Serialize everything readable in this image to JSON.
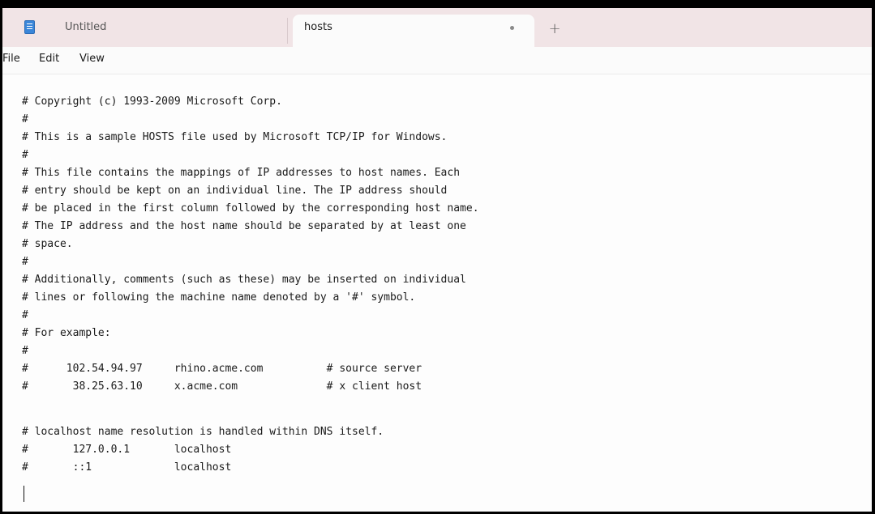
{
  "tabs": [
    {
      "label": "Untitled",
      "active": false
    },
    {
      "label": "hosts",
      "active": true,
      "unsaved_indicator": "•"
    }
  ],
  "new_tab_label": "+",
  "menu": [
    "File",
    "Edit",
    "View"
  ],
  "editor": {
    "lines": [
      "# Copyright (c) 1993-2009 Microsoft Corp.",
      "#",
      "# This is a sample HOSTS file used by Microsoft TCP/IP for Windows.",
      "#",
      "# This file contains the mappings of IP addresses to host names. Each",
      "# entry should be kept on an individual line. The IP address should",
      "# be placed in the first column followed by the corresponding host name.",
      "# The IP address and the host name should be separated by at least one",
      "# space.",
      "#",
      "# Additionally, comments (such as these) may be inserted on individual",
      "# lines or following the machine name denoted by a '#' symbol.",
      "#",
      "# For example:",
      "#",
      "#      102.54.94.97     rhino.acme.com          # source server",
      "#       38.25.63.10     x.acme.com              # x client host",
      "",
      "# localhost name resolution is handled within DNS itself.",
      "#       127.0.0.1       localhost",
      "#       ::1             localhost"
    ]
  },
  "colors": {
    "tabbar": "#f1e4e6",
    "editor_background": "#fdfdfd",
    "text": "#1a1a1a"
  }
}
